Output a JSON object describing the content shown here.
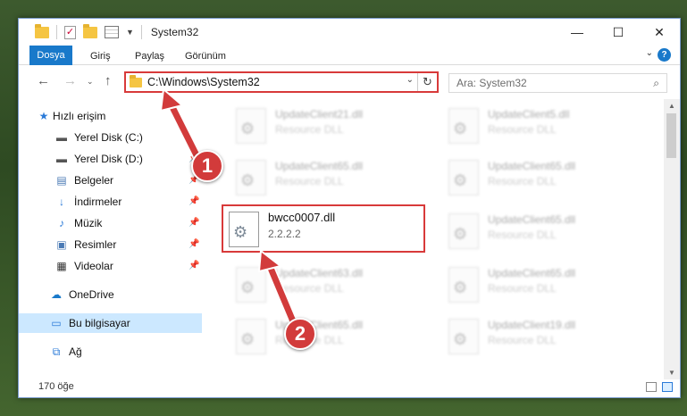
{
  "window": {
    "title": "System32"
  },
  "ribbon": {
    "tabs": [
      "Dosya",
      "Giriş",
      "Paylaş",
      "Görünüm"
    ]
  },
  "address": {
    "path": "C:\\Windows\\System32"
  },
  "search": {
    "placeholder": "Ara: System32"
  },
  "sidebar": {
    "items": [
      {
        "label": "Hızlı erişim",
        "icon": "star-icon"
      },
      {
        "label": "Yerel Disk (C:)",
        "icon": "drive-icon"
      },
      {
        "label": "Yerel Disk (D:)",
        "icon": "drive-icon"
      },
      {
        "label": "Belgeler",
        "icon": "document-icon"
      },
      {
        "label": "İndirmeler",
        "icon": "download-icon"
      },
      {
        "label": "Müzik",
        "icon": "music-icon"
      },
      {
        "label": "Resimler",
        "icon": "picture-icon"
      },
      {
        "label": "Videolar",
        "icon": "video-icon"
      },
      {
        "label": "OneDrive",
        "icon": "cloud-icon"
      },
      {
        "label": "Bu bilgisayar",
        "icon": "computer-icon"
      },
      {
        "label": "Ağ",
        "icon": "network-icon"
      }
    ]
  },
  "files": [
    {
      "name": "UpdateClient21.dll",
      "sub": "Resource DLL"
    },
    {
      "name": "UpdateClient5.dll",
      "sub": "Resource DLL"
    },
    {
      "name": "UpdateClient65.dll",
      "sub": "Resource DLL"
    },
    {
      "name": "UpdateClient65.dll",
      "sub": "Resource DLL"
    },
    {
      "name": "bwcc0007.dll",
      "sub": "2.2.2.2"
    },
    {
      "name": "UpdateClient65.dll",
      "sub": "Resource DLL"
    },
    {
      "name": "UpdateClient63.dll",
      "sub": "Resource DLL"
    },
    {
      "name": "UpdateClient65.dll",
      "sub": "Resource DLL"
    },
    {
      "name": "UpdateClient65.dll",
      "sub": "Resource DLL"
    },
    {
      "name": "UpdateClient19.dll",
      "sub": "Resource DLL"
    }
  ],
  "status": {
    "count": "170 öğe"
  },
  "callouts": {
    "one": "1",
    "two": "2"
  },
  "colors": {
    "accent": "#1979ca",
    "highlight": "#d83a3a",
    "selection": "#cce8ff"
  }
}
